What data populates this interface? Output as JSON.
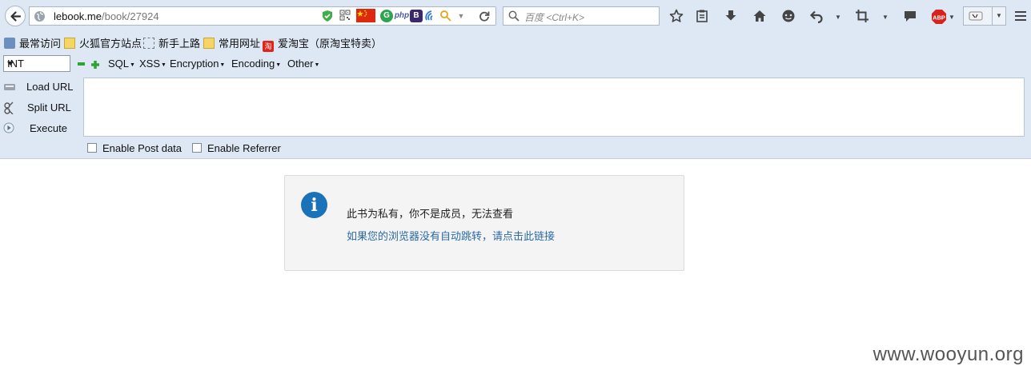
{
  "navbar": {
    "url_host": "lebook.me",
    "url_path": "/book/27924",
    "search_placeholder": "百度 <Ctrl+K>",
    "addons": [
      "shield-icon",
      "qr-icon",
      "flag-icon",
      "g-icon",
      "php-icon",
      "b-icon",
      "wave-icon",
      "key-icon"
    ]
  },
  "bookmarks": [
    {
      "label": "最常访问",
      "icon": "bookmark-icon"
    },
    {
      "label": "火狐官方站点",
      "icon": "folder-icon"
    },
    {
      "label": "新手上路",
      "icon": "dashed-box-icon"
    },
    {
      "label": "常用网址",
      "icon": "folder-icon"
    },
    {
      "label": "爱淘宝（原淘宝特卖）",
      "icon": "taobao-icon"
    }
  ],
  "hackbar": {
    "select_value": "INT",
    "menus": [
      "SQL",
      "XSS",
      "Encryption",
      "Encoding",
      "Other"
    ],
    "load_url": "Load URL",
    "split_url": "Split URL",
    "execute": "Execute",
    "enable_post": "Enable Post data",
    "enable_referrer": "Enable Referrer",
    "textarea_value": ""
  },
  "notice": {
    "title": "此书为私有，你不是成员，无法查看",
    "link": "如果您的浏览器没有自动跳转，请点击此链接"
  },
  "watermark": "www.wooyun.org",
  "colors": {
    "chrome_bg": "#dde8f4",
    "link": "#2b6aa8",
    "info_icon": "#1a73b8"
  }
}
